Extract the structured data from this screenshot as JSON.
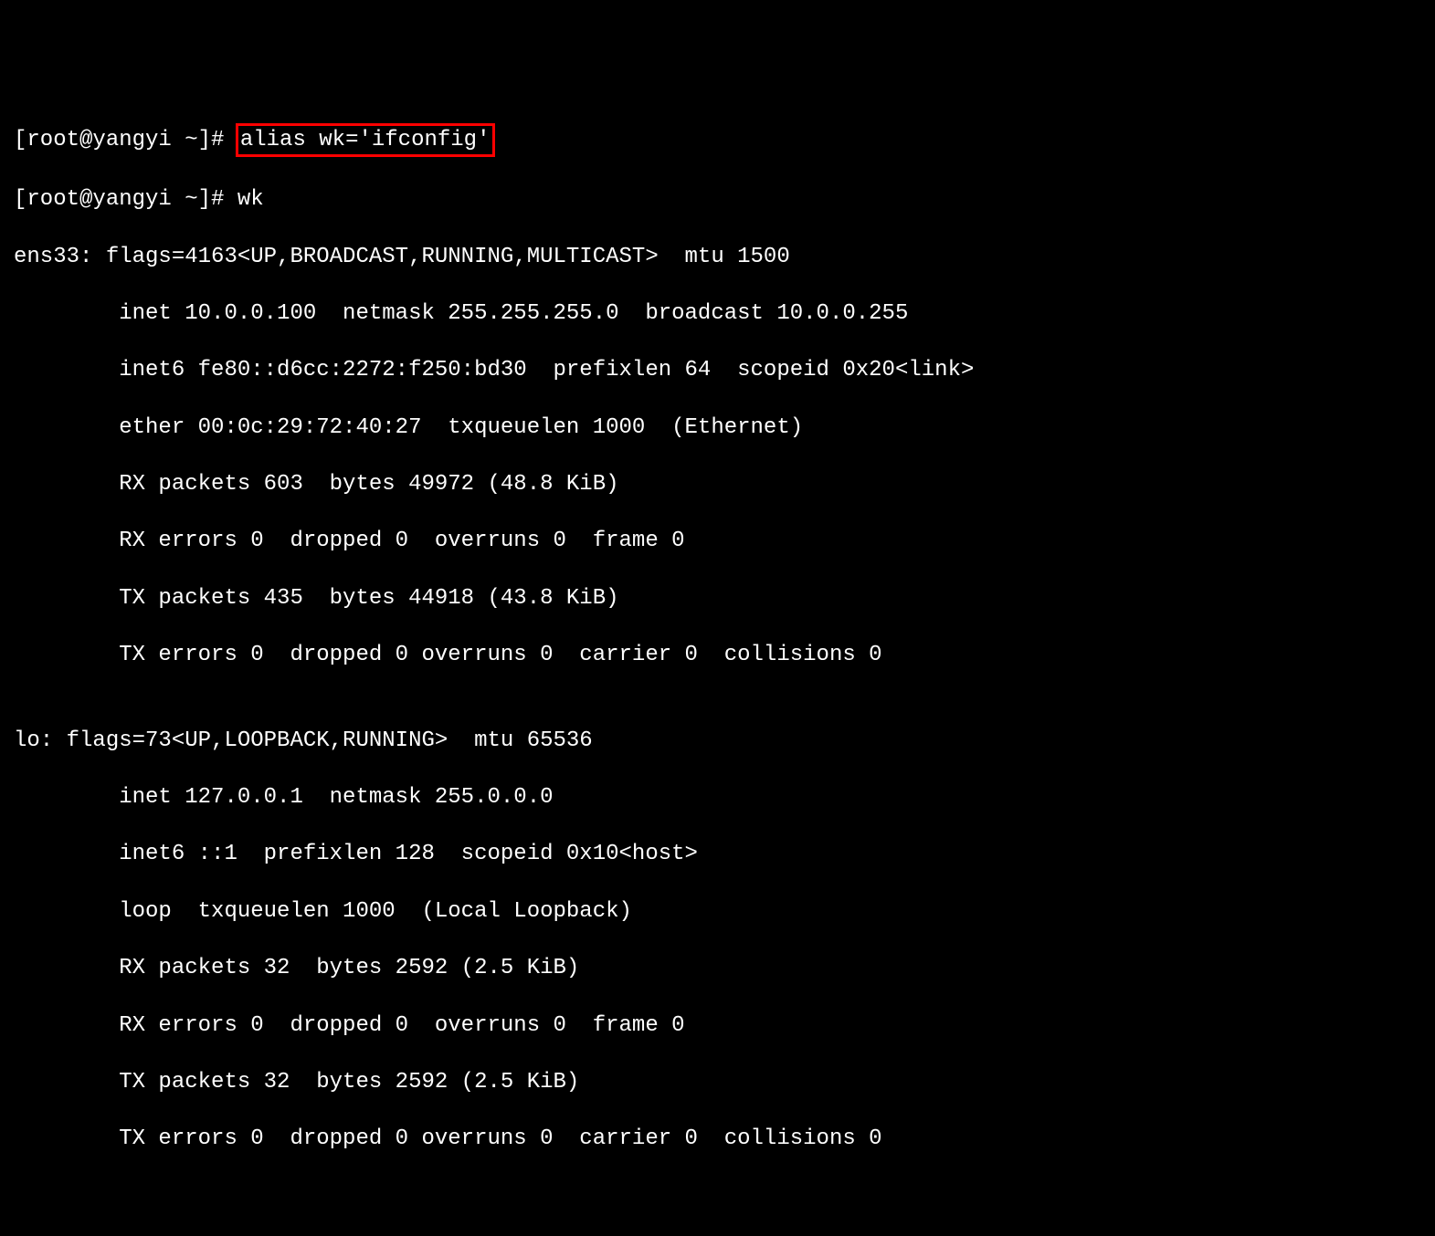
{
  "prompt1_prefix": "[root@yangyi ~]# ",
  "prompt1_command": "alias wk='ifconfig'",
  "prompt2_prefix": "[root@yangyi ~]# ",
  "prompt2_command": "wk",
  "ens33": {
    "header": "ens33: flags=4163<UP,BROADCAST,RUNNING,MULTICAST>  mtu 1500",
    "inet": "        inet 10.0.0.100  netmask 255.255.255.0  broadcast 10.0.0.255",
    "inet6": "        inet6 fe80::d6cc:2272:f250:bd30  prefixlen 64  scopeid 0x20<link>",
    "ether": "        ether 00:0c:29:72:40:27  txqueuelen 1000  (Ethernet)",
    "rx_packets": "        RX packets 603  bytes 49972 (48.8 KiB)",
    "rx_errors": "        RX errors 0  dropped 0  overruns 0  frame 0",
    "tx_packets": "        TX packets 435  bytes 44918 (43.8 KiB)",
    "tx_errors": "        TX errors 0  dropped 0 overruns 0  carrier 0  collisions 0"
  },
  "blank": "",
  "lo": {
    "header": "lo: flags=73<UP,LOOPBACK,RUNNING>  mtu 65536",
    "inet": "        inet 127.0.0.1  netmask 255.0.0.0",
    "inet6": "        inet6 ::1  prefixlen 128  scopeid 0x10<host>",
    "loop": "        loop  txqueuelen 1000  (Local Loopback)",
    "rx_packets": "        RX packets 32  bytes 2592 (2.5 KiB)",
    "rx_errors": "        RX errors 0  dropped 0  overruns 0  frame 0",
    "tx_packets": "        TX packets 32  bytes 2592 (2.5 KiB)",
    "tx_errors": "        TX errors 0  dropped 0 overruns 0  carrier 0  collisions 0"
  }
}
